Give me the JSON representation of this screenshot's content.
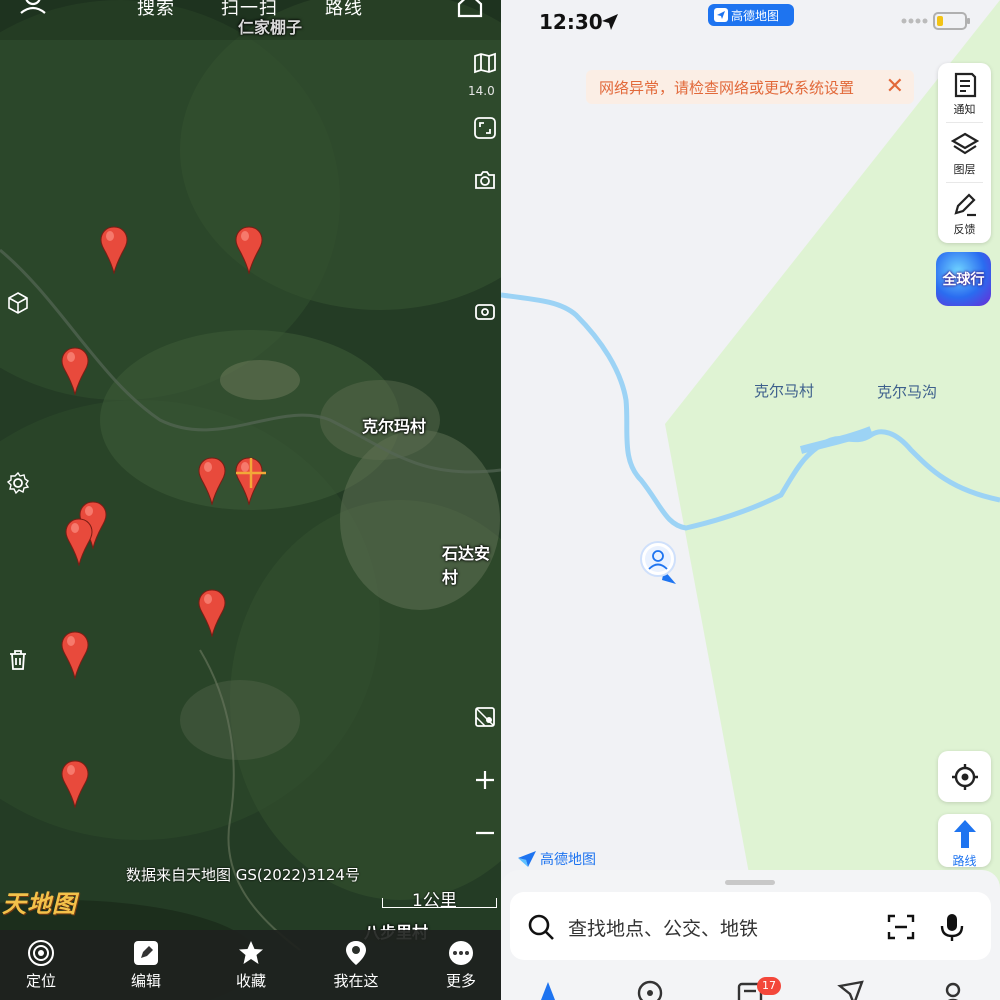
{
  "left_app": {
    "top_nav": {
      "search": "搜索",
      "scan": "扫一扫",
      "route": "路线"
    },
    "zoom_level": "14.0",
    "place_labels": {
      "top": "仁家棚子",
      "village": "克尔玛村",
      "east": "石达安村",
      "bottom": "八步里村"
    },
    "attribution": "数据来自天地图 GS(2022)3124号",
    "scale": "1公里",
    "logo": "天地图",
    "tabs": [
      {
        "label": "定位",
        "icon": "locate-icon"
      },
      {
        "label": "编辑",
        "icon": "edit-icon"
      },
      {
        "label": "收藏",
        "icon": "star-icon"
      },
      {
        "label": "我在这",
        "icon": "pin-icon"
      },
      {
        "label": "更多",
        "icon": "more-icon"
      }
    ],
    "pin_color": "#e84a3c"
  },
  "right_app": {
    "status": {
      "time": "12:30",
      "app_badge": "高德地图"
    },
    "banner": {
      "text": "网络异常，请检查网络或更改系统设置",
      "close": "✕"
    },
    "side_panel": {
      "notify": "通知",
      "layers": "图层",
      "feedback": "反馈"
    },
    "globe_button": "全球行",
    "map_labels": {
      "village": "克尔马村",
      "gully": "克尔马沟"
    },
    "route_button": "路线",
    "logo": "高德地图",
    "search_placeholder": "查找地点、公交、地铁",
    "message_badge": "17",
    "colors": {
      "accent": "#1e74f0",
      "green_area": "#dff3d3",
      "river": "#9cd3f5",
      "banner_text": "#e2693a"
    }
  }
}
